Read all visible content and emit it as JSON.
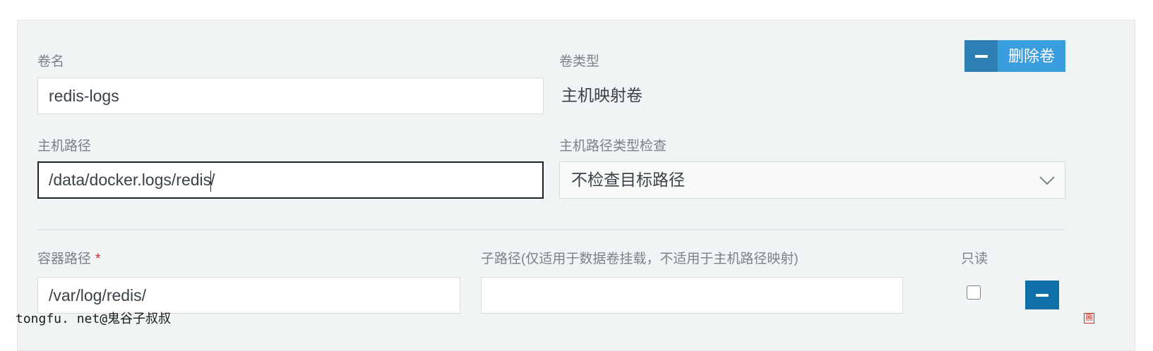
{
  "volume": {
    "name_label": "卷名",
    "name_value": "redis-logs",
    "type_label": "卷类型",
    "type_value": "主机映射卷",
    "remove_button_label": "删除卷",
    "host_path_label": "主机路径",
    "host_path_value_before_caret": "/data/docker.logs/redis",
    "host_path_value_after_caret": "/",
    "host_path_check_label": "主机路径类型检查",
    "host_path_check_selected": "不检查目标路径"
  },
  "mount": {
    "container_path_label": "容器路径",
    "required_marker": "*",
    "container_path_value": "/var/log/redis/",
    "subpath_label": "子路径(仅适用于数据卷挂载，不适用于主机路径映射)",
    "subpath_value": "",
    "readonly_label": "只读",
    "readonly_checked": false
  },
  "watermark": {
    "text": "tongfu. net@鬼谷子叔叔",
    "corner_glyph": "圖"
  },
  "icons": {
    "remove_volume": "minus-icon",
    "remove_row": "minus-icon",
    "select_arrow": "chevron-down-icon"
  },
  "colors": {
    "panel_bg": "#f1f4f5",
    "button_primary": "#3a9ede",
    "button_primary_dark": "#2e7fb4",
    "button_remove_row": "#0f6fa6",
    "required": "#d9262b"
  }
}
